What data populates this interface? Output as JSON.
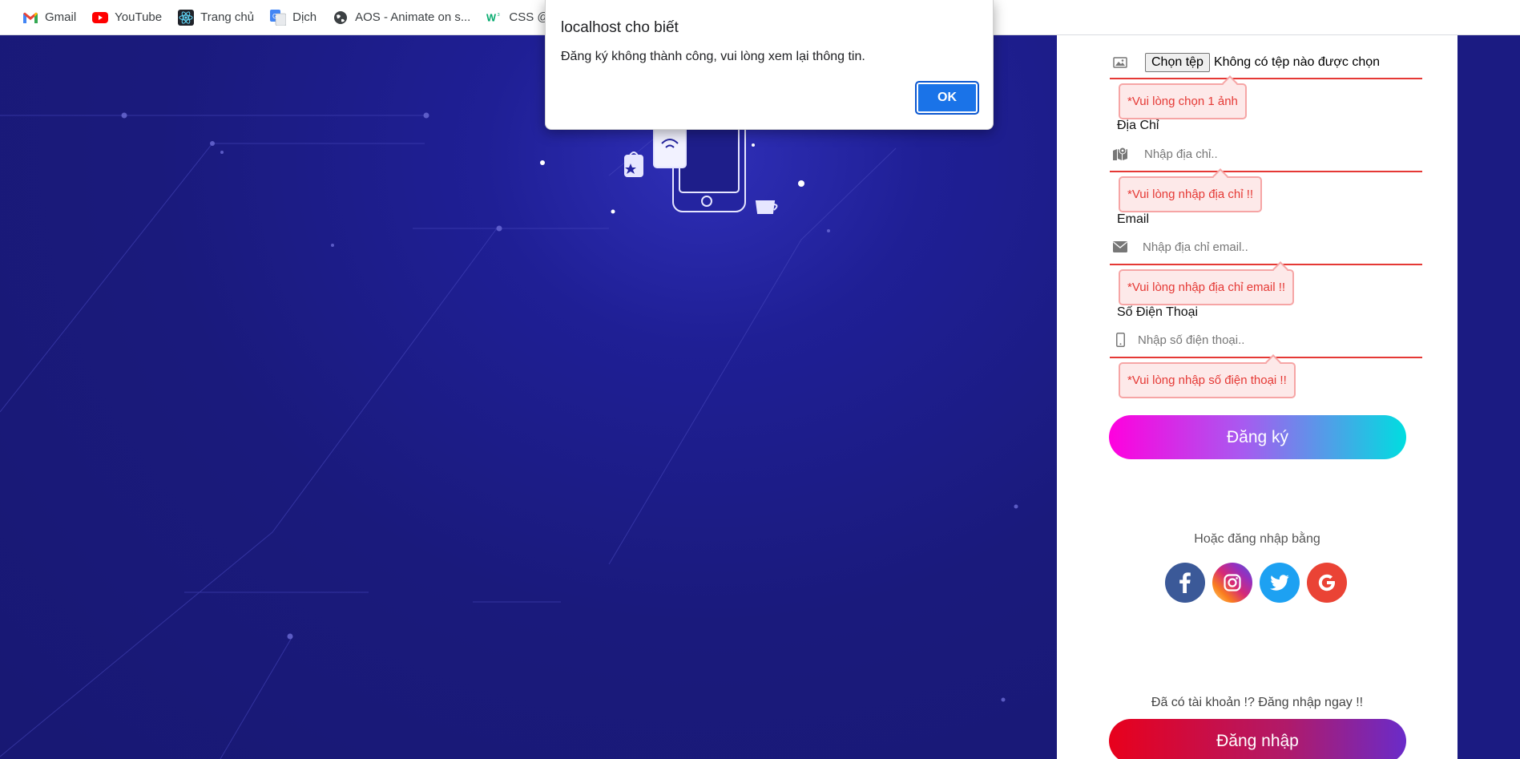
{
  "bookmarks": [
    {
      "label": "Gmail",
      "icon": "gmail-icon"
    },
    {
      "label": "YouTube",
      "icon": "youtube-icon"
    },
    {
      "label": "Trang chủ",
      "icon": "react-icon"
    },
    {
      "label": "Dịch",
      "icon": "google-translate-icon"
    },
    {
      "label": "AOS - Animate on s...",
      "icon": "globe-icon"
    },
    {
      "label": "CSS @k",
      "icon": "w3schools-icon"
    }
  ],
  "dialog": {
    "title": "localhost cho biết",
    "message": "Đăng ký không thành công, vui lòng xem lại thông tin.",
    "ok_label": "OK"
  },
  "form": {
    "file_button": "Chọn tệp",
    "file_status": "Không có tệp nào được chọn",
    "file_error": "*Vui lòng chọn 1 ảnh",
    "address_label": "Địa Chỉ",
    "address_placeholder": "Nhập địa chỉ..",
    "address_error": "*Vui lòng nhập địa chỉ !!",
    "email_label": "Email",
    "email_placeholder": "Nhập địa chỉ email..",
    "email_error": "*Vui lòng nhập địa chỉ email !!",
    "phone_label": "Số Điện Thoại",
    "phone_placeholder": "Nhập số điện thoại..",
    "phone_error": "*Vui lòng nhập số điện thoại !!",
    "register_button": "Đăng ký",
    "or_login_text": "Hoặc đăng nhập bằng",
    "socials": [
      "facebook-icon",
      "instagram-icon",
      "twitter-icon",
      "google-icon"
    ],
    "have_account_text": "Đã có tài khoản !? Đăng nhập ngay !!",
    "login_button": "Đăng nhập"
  },
  "colors": {
    "background": "#1a1a7a",
    "error": "#e53935",
    "dialog_ok": "#1a73e8",
    "facebook": "#3b5998",
    "twitter": "#1da1f2",
    "google": "#ea4335"
  }
}
